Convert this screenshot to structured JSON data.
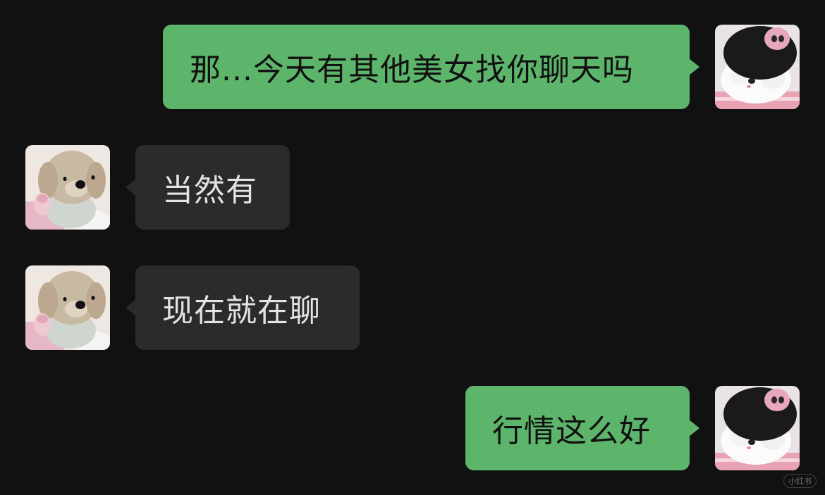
{
  "conversation": {
    "messages": [
      {
        "sender": "me",
        "text": "那...今天有其他美女找你聊天吗"
      },
      {
        "sender": "contact",
        "text": "当然有"
      },
      {
        "sender": "contact",
        "text": "现在就在聊"
      },
      {
        "sender": "me",
        "text": "行情这么好"
      }
    ]
  },
  "avatars": {
    "me": "cat-with-plush-hat-avatar",
    "contact": "plush-puppy-avatar"
  },
  "colors": {
    "background": "#111111",
    "outgoing_bubble": "#5db56c",
    "incoming_bubble": "#2b2b2b",
    "incoming_text": "#e3e3e3",
    "outgoing_text": "#111111"
  },
  "watermark": "小红书"
}
